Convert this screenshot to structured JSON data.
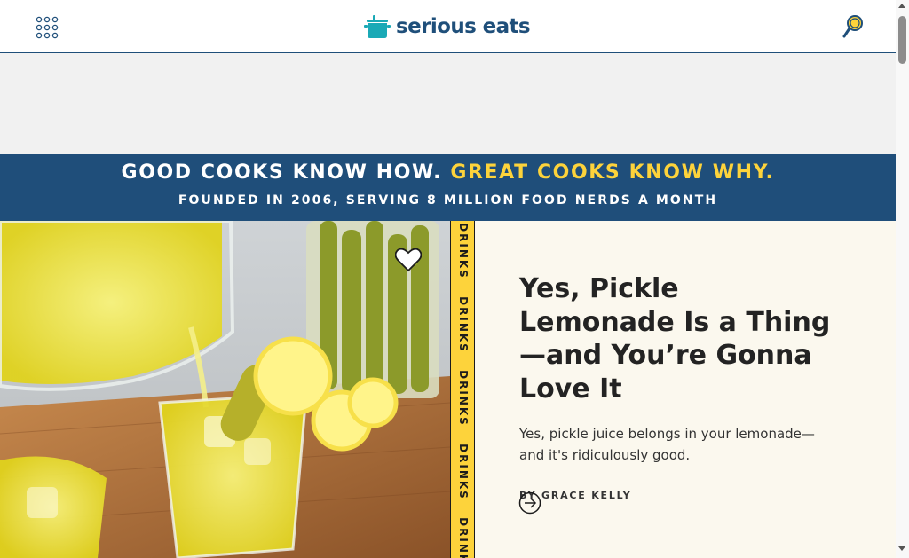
{
  "header": {
    "logo_text": "serious eats",
    "menu_icon": "grid-menu-icon",
    "search_icon": "search-icon",
    "brand_color": "#1f4f7a",
    "logo_accent_color": "#1aa9b6"
  },
  "banner": {
    "line1_part1": "GOOD COOKS KNOW HOW.",
    "line1_part2": "GREAT COOKS KNOW WHY.",
    "line2": "FOUNDED IN 2006, SERVING 8 MILLION FOOD NERDS A MONTH",
    "background_color": "#1f4e7a",
    "accent_color": "#fdd33b"
  },
  "feature": {
    "tag_label": "DRINKS",
    "title": "Yes, Pickle Lemonade Is a Thing—and You’re Gonna Love It",
    "dek": "Yes, pickle juice belongs in your lemonade—and it's ridiculously good.",
    "byline_prefix": "BY",
    "author": "GRACE KELLY",
    "save_icon": "heart-icon",
    "read_icon": "arrow-right-circle-icon",
    "background_color": "#fbf8ee",
    "tag_strip_color": "#fdd33b"
  }
}
